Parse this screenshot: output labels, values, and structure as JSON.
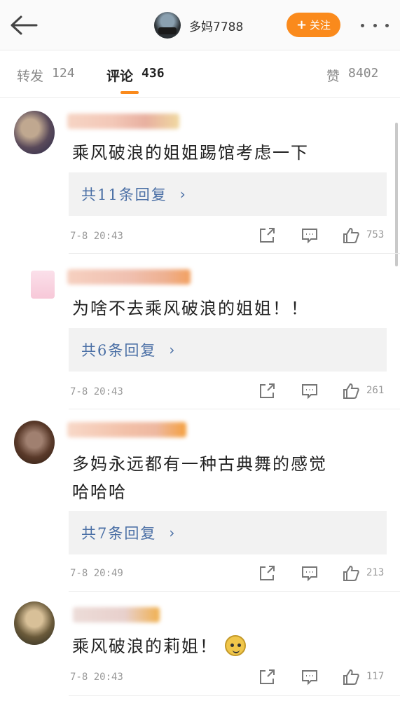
{
  "header": {
    "username": "多妈7788",
    "follow_label": "关注"
  },
  "tabs": [
    {
      "label": "转发",
      "count": "124"
    },
    {
      "label": "评论",
      "count": "436"
    },
    {
      "label": "赞",
      "count": "8402"
    }
  ],
  "colors": {
    "accent": "#fa8a1c",
    "link": "#4a6fa5"
  },
  "comments": [
    {
      "text": "乘风破浪的姐姐踢馆考虑一下",
      "reply_label": "共11条回复",
      "time": "7-8 20:43",
      "likes": "753"
    },
    {
      "text": "为啥不去乘风破浪的姐姐！！",
      "reply_label": "共6条回复",
      "time": "7-8 20:43",
      "likes": "261"
    },
    {
      "text_line1": "多妈永远都有一种古典舞的感觉",
      "text_line2": "哈哈哈",
      "reply_label": "共7条回复",
      "time": "7-8 20:49",
      "likes": "213"
    },
    {
      "text": "乘风破浪的莉姐！",
      "emoji": "doge-emoji-icon",
      "time": "7-8 20:43",
      "likes": "117"
    }
  ]
}
